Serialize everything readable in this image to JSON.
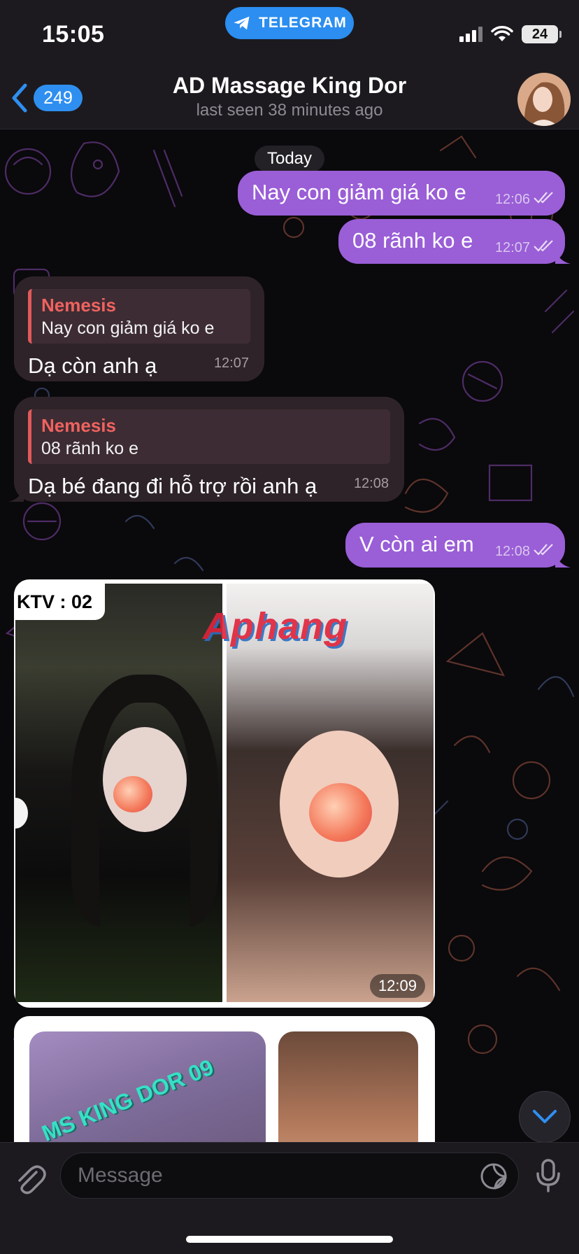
{
  "status_bar": {
    "time": "15:05",
    "app_pill": "TELEGRAM",
    "battery": "24"
  },
  "header": {
    "back_count": "249",
    "title": "AD Massage King Dor",
    "subtitle": "last seen 38 minutes ago"
  },
  "chat": {
    "date_label": "Today",
    "messages": [
      {
        "type": "outgoing",
        "text": "Nay con giảm giá ko e",
        "time": "12:06",
        "status": "read"
      },
      {
        "type": "outgoing",
        "text": "08 rãnh ko e",
        "time": "12:07",
        "status": "read"
      },
      {
        "type": "incoming",
        "reply_name": "Nemesis",
        "reply_text": "Nay con giảm giá ko e",
        "text": "Dạ còn anh ạ",
        "time": "12:07"
      },
      {
        "type": "incoming",
        "reply_name": "Nemesis",
        "reply_text": "08 rãnh ko e",
        "text": "Dạ bé đang đi hỗ trợ rồi anh ạ",
        "time": "12:08"
      },
      {
        "type": "outgoing",
        "text": "V còn ai em",
        "time": "12:08",
        "status": "read"
      },
      {
        "type": "photo",
        "label": "KTV : 02",
        "watermark": "Aphang",
        "time": "12:09"
      },
      {
        "type": "photo",
        "overlay_text": "MS KING DOR 09"
      }
    ]
  },
  "input": {
    "placeholder": "Message"
  },
  "colors": {
    "outgoing_bubble": "#9a5ed7",
    "incoming_bubble": "#2e2329",
    "reply_accent": "#e05a5a",
    "accent_blue": "#2f8ff0"
  },
  "icons": [
    "telegram-plane-icon",
    "signal-icon",
    "wifi-icon",
    "battery-icon",
    "chevron-left-icon",
    "double-check-icon",
    "chevron-down-icon",
    "paperclip-icon",
    "sticker-icon",
    "microphone-icon"
  ]
}
